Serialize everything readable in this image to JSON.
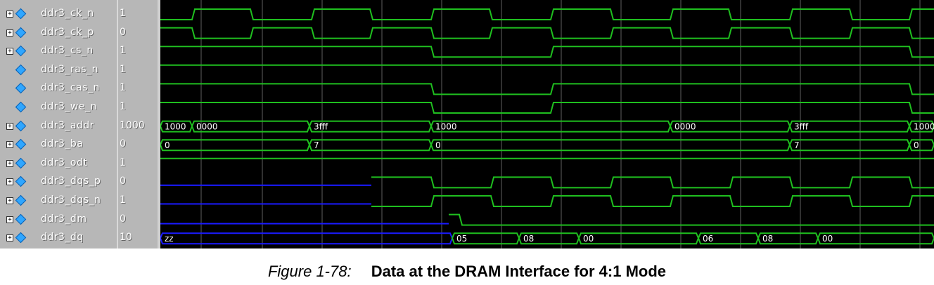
{
  "signals": [
    {
      "name": "ddr3_ck_n",
      "value": "1",
      "expander": true
    },
    {
      "name": "ddr3_ck_p",
      "value": "0",
      "expander": true
    },
    {
      "name": "ddr3_cs_n",
      "value": "1",
      "expander": true
    },
    {
      "name": "ddr3_ras_n",
      "value": "1",
      "expander": false
    },
    {
      "name": "ddr3_cas_n",
      "value": "1",
      "expander": false
    },
    {
      "name": "ddr3_we_n",
      "value": "1",
      "expander": false
    },
    {
      "name": "ddr3_addr",
      "value": "1000",
      "expander": true
    },
    {
      "name": "ddr3_ba",
      "value": "0",
      "expander": true
    },
    {
      "name": "ddr3_odt",
      "value": "1",
      "expander": true
    },
    {
      "name": "ddr3_dqs_p",
      "value": "0",
      "expander": true
    },
    {
      "name": "ddr3_dqs_n",
      "value": "1",
      "expander": true
    },
    {
      "name": "ddr3_dm",
      "value": "0",
      "expander": true
    },
    {
      "name": "ddr3_dq",
      "value": "10",
      "expander": true
    }
  ],
  "bus_values": {
    "ddr3_addr": [
      "1000",
      "0000",
      "3fff",
      "1000",
      "0000",
      "3fff",
      "1000"
    ],
    "ddr3_ba": [
      "0",
      "7",
      "0",
      "7",
      "0"
    ],
    "ddr3_dq": [
      "zz",
      "05",
      "08",
      "00",
      "06",
      "08",
      "00"
    ]
  },
  "colors": {
    "signal": "#1fbf1f",
    "undriven": "#1a1aff",
    "grid": "#606060",
    "background": "#000000"
  },
  "caption": {
    "label": "Figure 1-78:",
    "title": "Data at the DRAM Interface for 4:1 Mode"
  }
}
